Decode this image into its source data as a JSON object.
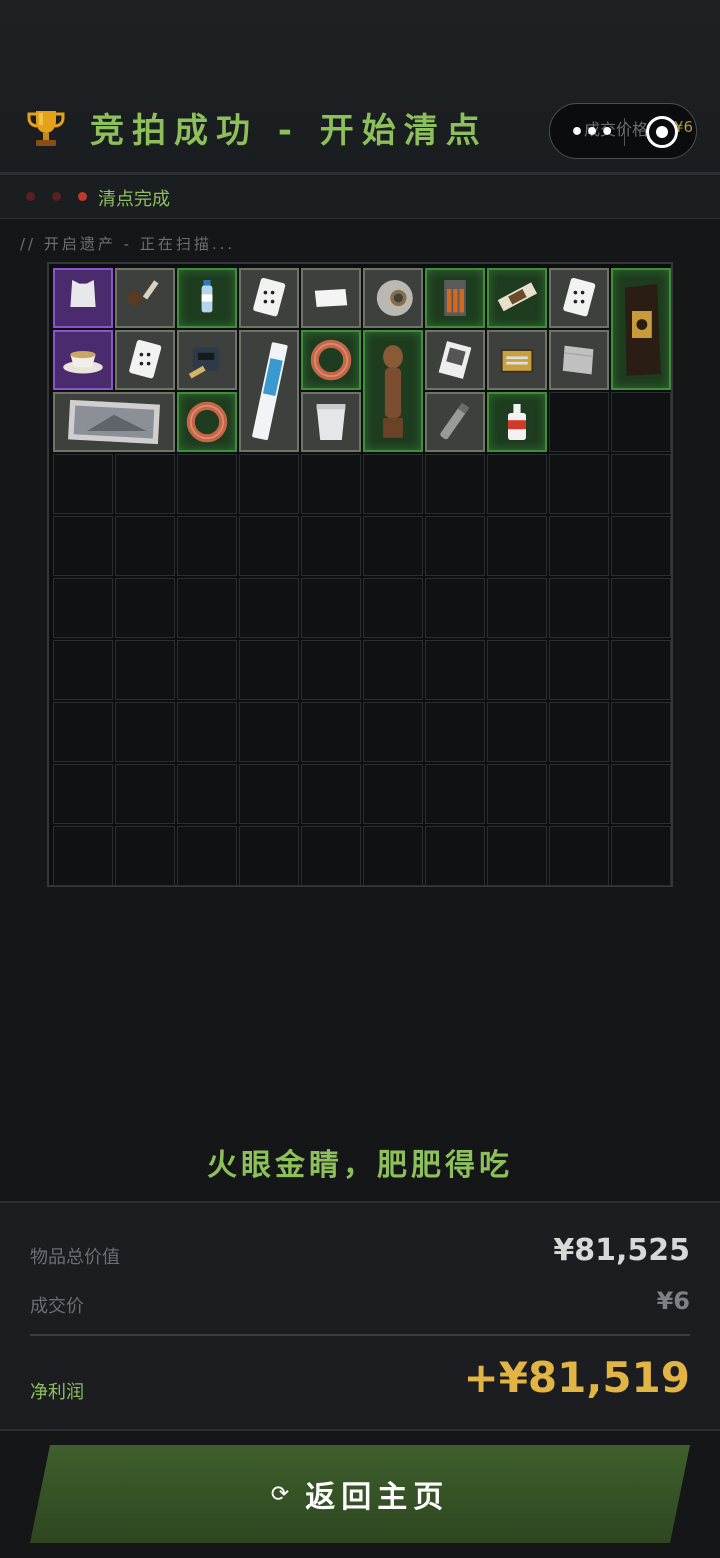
{
  "header": {
    "title": "竞拍成功 - 开始清点",
    "trophy_icon": "trophy-icon",
    "capsule": {
      "ghost_label": "成交价格",
      "ghost_price": "¥6"
    }
  },
  "status": {
    "label": "清点完成",
    "dot_colors": [
      "#5a1f1f",
      "#5a1f1f",
      "#c0392b"
    ]
  },
  "scan_text": "// 开启遗产 - 正在扫描...",
  "inventory": {
    "columns": 10,
    "rows": 10,
    "items": [
      {
        "name": "body-armor-icon",
        "rarity": "purple"
      },
      {
        "name": "paint-brush-icon",
        "rarity": "gray"
      },
      {
        "name": "water-bottle-icon",
        "rarity": "green"
      },
      {
        "name": "playing-card-icon",
        "rarity": "gray"
      },
      {
        "name": "napkin-icon",
        "rarity": "gray"
      },
      {
        "name": "duct-tape-icon",
        "rarity": "gray"
      },
      {
        "name": "battery-pack-icon",
        "rarity": "green"
      },
      {
        "name": "snack-bar-icon",
        "rarity": "green"
      },
      {
        "name": "playing-card-icon",
        "rarity": "gray"
      },
      {
        "name": "coffee-bag-icon",
        "rarity": "green"
      },
      {
        "name": "teacup-icon",
        "rarity": "purple"
      },
      {
        "name": "playing-card-icon",
        "rarity": "gray"
      },
      {
        "name": "tape-measure-icon",
        "rarity": "gray"
      },
      {
        "name": "toothpaste-icon",
        "rarity": "gray"
      },
      {
        "name": "cable-coil-icon",
        "rarity": "green"
      },
      {
        "name": "wooden-statue-icon",
        "rarity": "green"
      },
      {
        "name": "photo-card-icon",
        "rarity": "gray"
      },
      {
        "name": "nails-box-icon",
        "rarity": "gray"
      },
      {
        "name": "cloth-icon",
        "rarity": "gray"
      },
      {
        "name": "photograph-icon",
        "rarity": "gray"
      },
      {
        "name": "cable-coil-icon",
        "rarity": "green"
      },
      {
        "name": "yogurt-cup-icon",
        "rarity": "gray"
      },
      {
        "name": "flashlight-icon",
        "rarity": "gray"
      },
      {
        "name": "glue-bottle-icon",
        "rarity": "green"
      }
    ]
  },
  "slogan": "火眼金睛，肥肥得吃",
  "summary": {
    "total_label": "物品总价值",
    "total_value": "¥81,525",
    "deal_label": "成交价",
    "deal_value": "¥6",
    "profit_label": "净利润",
    "profit_value": "+¥81,519"
  },
  "button": {
    "icon": "refresh-icon",
    "label": "返回主页"
  },
  "colors": {
    "accent_green": "#8dbf5a",
    "profit_gold": "#e2b443",
    "button_green": "#3f5f2c"
  }
}
